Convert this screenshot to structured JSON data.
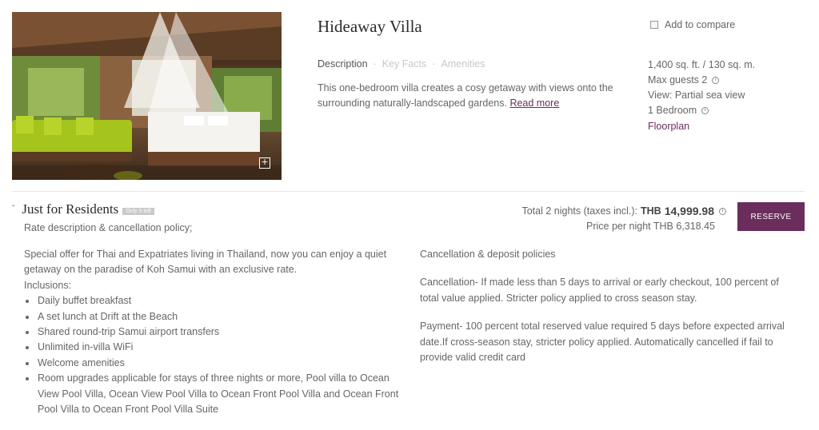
{
  "villa": {
    "title": "Hideaway Villa",
    "tabs": [
      "Description",
      "Key Facts",
      "Amenities"
    ],
    "description": "This one-bedroom villa creates a cosy getaway with views onto the surrounding naturally-landscaped gardens.",
    "read_more": "Read more",
    "compare_label": "Add to compare",
    "facts": {
      "size": "1,400 sq. ft. / 130 sq. m.",
      "guests": "Max guests 2",
      "view": "View: Partial sea view",
      "bedrooms": "1 Bedroom",
      "floorplan": "Floorplan"
    },
    "zoom_symbol": "+"
  },
  "rate": {
    "title": "Just for Residents",
    "badge": "Only 5 left",
    "subtitle": "Rate description & cancellation policy;",
    "total_label": "Total 2 nights (taxes incl.):",
    "currency": "THB",
    "total_amount": "14,999.98",
    "per_night": "Price per night THB 6,318.45",
    "reserve_label": "RESERVE",
    "offer_intro": "Special offer for Thai and Expatriates living in Thailand, now you can enjoy a quiet getaway on the paradise of Koh Samui with an exclusive rate.",
    "inclusions_label": "Inclusions:",
    "inclusions": [
      "Daily buffet breakfast",
      "A set lunch at Drift at the Beach",
      "Shared round-trip Samui airport transfers",
      "Unlimited in-villa WiFi",
      "Welcome amenities",
      "Room upgrades applicable for stays of three nights or more, Pool villa to Ocean View Pool Villa, Ocean View Pool Villa to Ocean Front Pool Villa and Ocean Front Pool Villa to Ocean Front Pool Villa Suite"
    ],
    "policies_title": "Cancellation & deposit policies",
    "cancellation": "Cancellation- If made less than 5 days to arrival or early checkout, 100 percent of total value applied. Stricter policy applied to cross season stay.",
    "payment": "Payment- 100 percent total reserved value required 5 days before expected arrival date.If cross-season stay, stricter policy applied. Automatically cancelled if fail to provide valid credit card"
  },
  "colors": {
    "accent": "#6b2d5c",
    "badge": "#c9c9c9",
    "divider": "#e6e6e6"
  }
}
